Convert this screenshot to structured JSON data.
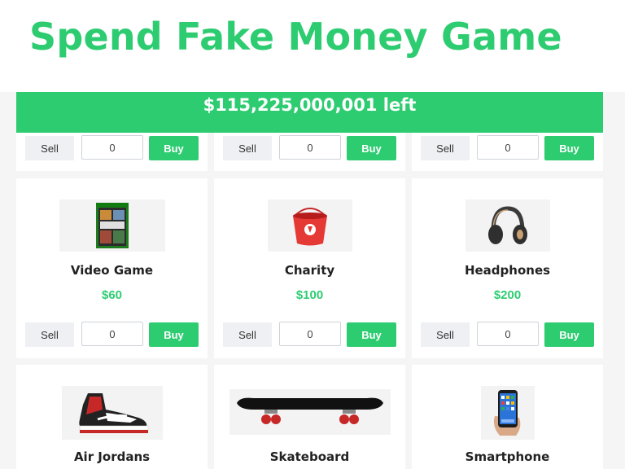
{
  "title": "Spend Fake Money Game",
  "money_left": "$115,225,000,001 left",
  "controls": {
    "sell_label": "Sell",
    "buy_label": "Buy"
  },
  "top_row": [
    {
      "quantity": "0"
    },
    {
      "quantity": "0"
    },
    {
      "quantity": "0"
    }
  ],
  "items": [
    {
      "name": "Video Game",
      "price": "$60",
      "quantity": "0",
      "icon": "video-game-case-icon"
    },
    {
      "name": "Charity",
      "price": "$100",
      "quantity": "0",
      "icon": "charity-bucket-icon"
    },
    {
      "name": "Headphones",
      "price": "$200",
      "quantity": "0",
      "icon": "headphones-icon"
    },
    {
      "name": "Air Jordans",
      "icon": "sneaker-icon"
    },
    {
      "name": "Skateboard",
      "icon": "skateboard-icon"
    },
    {
      "name": "Smartphone",
      "icon": "smartphone-icon"
    }
  ],
  "colors": {
    "accent": "#2ecc71",
    "background": "#f4f5f4",
    "sell_button": "#eef0f3"
  }
}
